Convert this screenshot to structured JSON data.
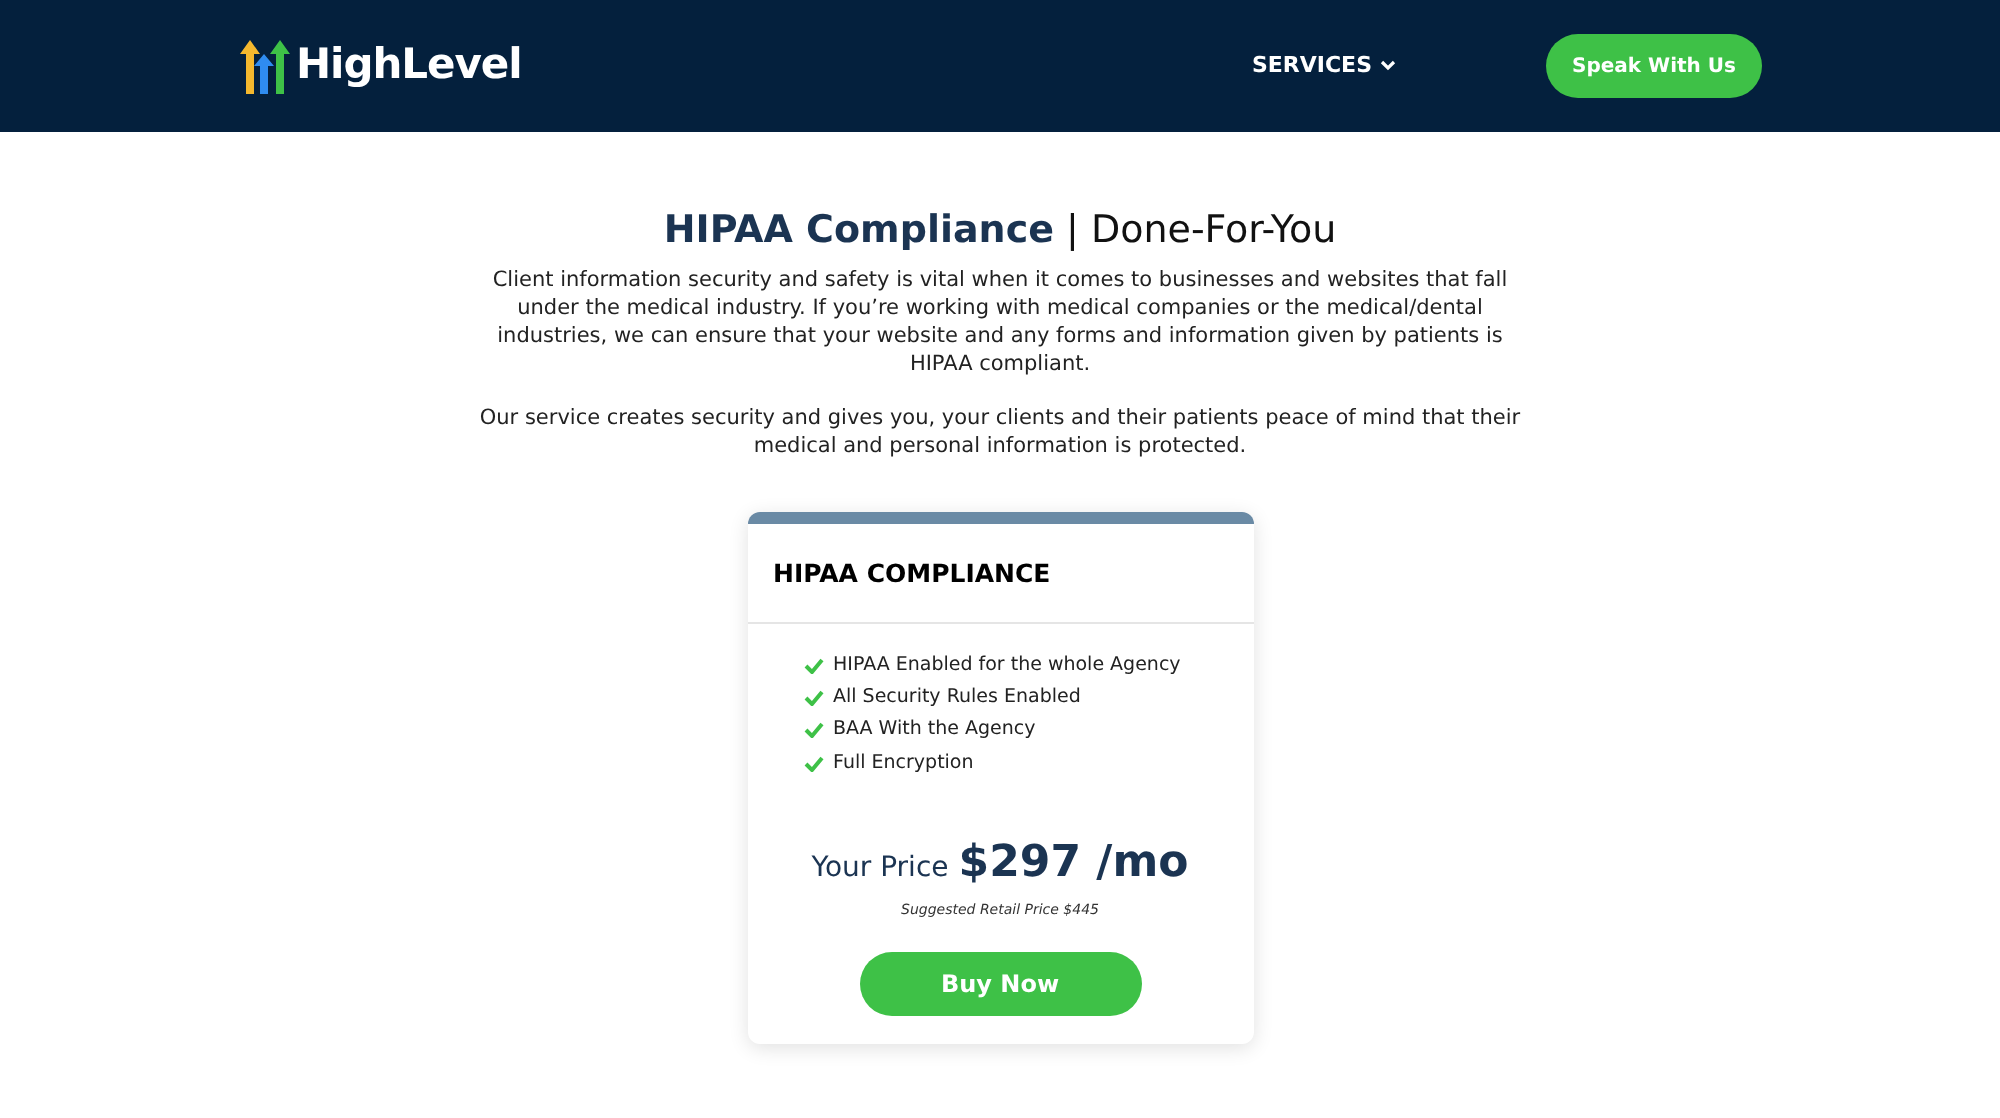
{
  "header": {
    "logo": "HighLevel",
    "nav": [
      {
        "label": "SERVICES"
      }
    ],
    "cta": "Speak With Us"
  },
  "intro": {
    "title_bold": "HIPAA Compliance",
    "title_rest": "| Done-For-You",
    "paragraphs": [
      "Client information security and safety is vital when it comes to businesses and websites that fall under the medical industry. If you’re working with medical companies or the medical/dental industries, we can ensure that your website and any forms and information given by patients is HIPAA compliant.",
      "Our service creates security and gives you, your clients and their patients peace of mind that their medical and personal information is protected."
    ]
  },
  "card": {
    "title": "HIPAA COMPLIANCE",
    "features": [
      "HIPAA Enabled for the whole Agency",
      "All Security Rules Enabled",
      "BAA With the Agency",
      "Full Encryption"
    ],
    "price_label": "Your Price",
    "price": "$297 /mo",
    "retail": "Suggested Retail Price $445",
    "button": "Buy Now"
  }
}
